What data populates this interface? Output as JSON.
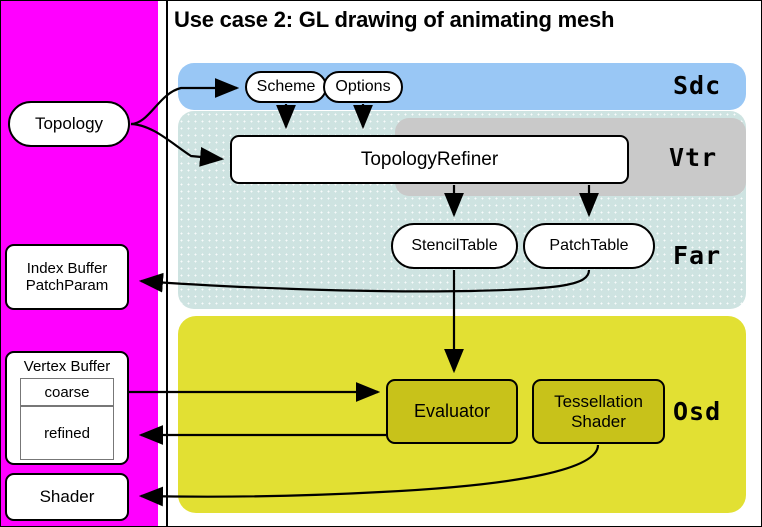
{
  "title": "Use case 2: GL drawing of animating mesh",
  "colors": {
    "client_panel": "#ff00ff",
    "sdc_band": "#99c7f5",
    "far_band": "#cee3e1",
    "vtr_band": "#c9c9c9",
    "osd_band": "#e2e033",
    "osd_node": "#c8c21a",
    "node_fill": "#ffffff",
    "stroke": "#000000"
  },
  "layers": [
    {
      "key": "sdc",
      "label": "Sdc"
    },
    {
      "key": "vtr",
      "label": "Vtr"
    },
    {
      "key": "far",
      "label": "Far"
    },
    {
      "key": "osd",
      "label": "Osd"
    }
  ],
  "client_nodes": {
    "topology": "Topology",
    "index_buffer_line1": "Index Buffer",
    "index_buffer_line2": "PatchParam",
    "vertex_buffer_title": "Vertex Buffer",
    "vertex_buffer_coarse": "coarse",
    "vertex_buffer_refined": "refined",
    "shader": "Shader"
  },
  "sdc_nodes": {
    "scheme": "Scheme",
    "options": "Options"
  },
  "vtr_nodes": {
    "topology_refiner": "TopologyRefiner"
  },
  "far_nodes": {
    "stencil_table": "StencilTable",
    "patch_table": "PatchTable"
  },
  "osd_nodes": {
    "evaluator": "Evaluator",
    "tessellation_shader_line1": "Tessellation",
    "tessellation_shader_line2": "Shader"
  },
  "edges": [
    {
      "from": "Topology",
      "to": "Scheme"
    },
    {
      "from": "Topology",
      "to": "TopologyRefiner"
    },
    {
      "from": "Scheme",
      "to": "TopologyRefiner"
    },
    {
      "from": "Options",
      "to": "TopologyRefiner"
    },
    {
      "from": "TopologyRefiner",
      "to": "StencilTable"
    },
    {
      "from": "TopologyRefiner",
      "to": "PatchTable"
    },
    {
      "from": "PatchTable",
      "to": "Index Buffer PatchParam"
    },
    {
      "from": "StencilTable",
      "to": "Evaluator"
    },
    {
      "from": "coarse",
      "to": "Evaluator"
    },
    {
      "from": "Evaluator",
      "to": "refined"
    },
    {
      "from": "Tessellation Shader",
      "to": "Shader"
    }
  ]
}
